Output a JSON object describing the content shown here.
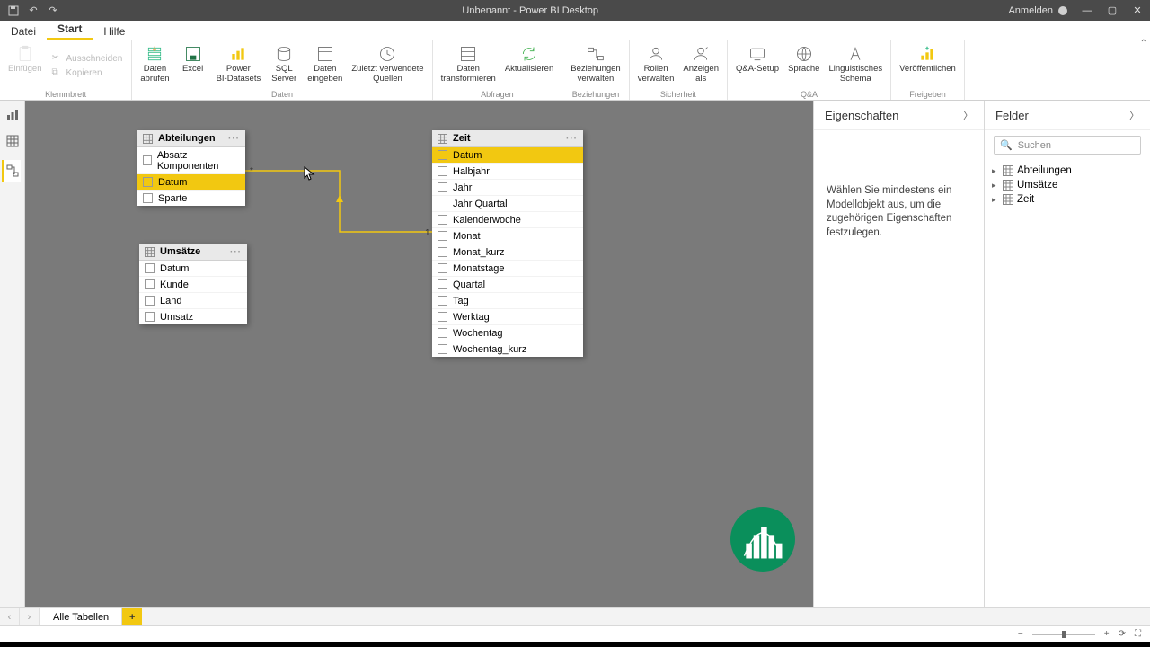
{
  "title_bar": {
    "title": "Unbenannt - Power BI Desktop",
    "login": "Anmelden"
  },
  "menu": {
    "file": "Datei",
    "home": "Start",
    "help": "Hilfe"
  },
  "ribbon": {
    "clipboard": {
      "paste": "Einfügen",
      "cut": "Ausschneiden",
      "copy": "Kopieren",
      "group": "Klemmbrett"
    },
    "data": {
      "get": "Daten\nabrufen",
      "excel": "Excel",
      "pbids": "Power\nBI-Datasets",
      "sql": "SQL\nServer",
      "enter": "Daten\neingeben",
      "recent": "Zuletzt verwendete\nQuellen",
      "group": "Daten"
    },
    "queries": {
      "transform": "Daten\ntransformieren",
      "refresh": "Aktualisieren",
      "group": "Abfragen"
    },
    "relationships": {
      "manage": "Beziehungen\nverwalten",
      "group": "Beziehungen"
    },
    "security": {
      "roles": "Rollen\nverwalten",
      "viewas": "Anzeigen\nals",
      "group": "Sicherheit"
    },
    "qa": {
      "setup": "Q&A-Setup",
      "lang": "Sprache",
      "ling": "Linguistisches\nSchema",
      "group": "Q&A"
    },
    "share": {
      "publish": "Veröffentlichen",
      "group": "Freigeben"
    }
  },
  "canvas": {
    "tables": {
      "abteilungen": {
        "name": "Abteilungen",
        "fields": [
          "Absatz Komponenten",
          "Datum",
          "Sparte"
        ],
        "selected": "Datum"
      },
      "umsaetze": {
        "name": "Umsätze",
        "fields": [
          "Datum",
          "Kunde",
          "Land",
          "Umsatz"
        ]
      },
      "zeit": {
        "name": "Zeit",
        "fields": [
          "Datum",
          "Halbjahr",
          "Jahr",
          "Jahr Quartal",
          "Kalenderwoche",
          "Monat",
          "Monat_kurz",
          "Monatstage",
          "Quartal",
          "Tag",
          "Werktag",
          "Wochentag",
          "Wochentag_kurz"
        ],
        "selected": "Datum"
      }
    },
    "relation": {
      "left_card": "*",
      "right_card": "1"
    }
  },
  "properties": {
    "title": "Eigenschaften",
    "placeholder": "Wählen Sie mindestens ein Modellobjekt aus, um die zugehörigen Eigenschaften festzulegen."
  },
  "fields": {
    "title": "Felder",
    "search_placeholder": "Suchen",
    "tables": [
      "Abteilungen",
      "Umsätze",
      "Zeit"
    ]
  },
  "bottom": {
    "tab": "Alle Tabellen"
  }
}
